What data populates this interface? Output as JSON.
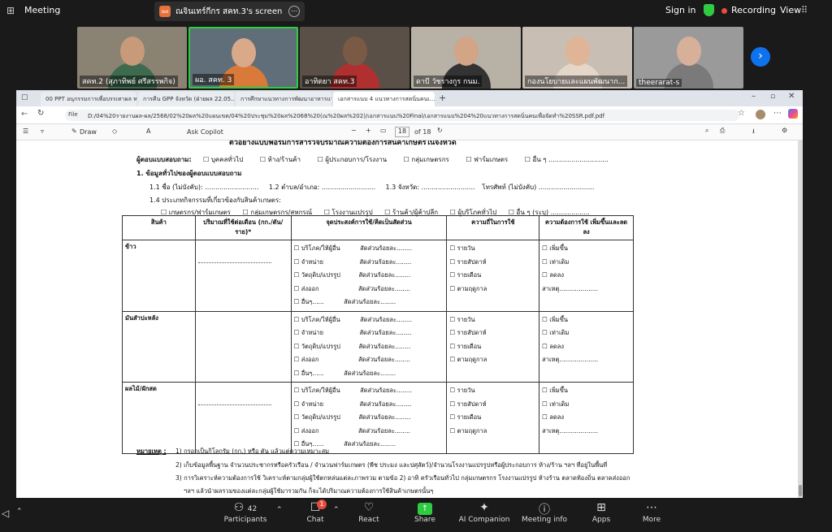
{
  "zoom": {
    "meeting_title": "Meeting",
    "share_label": "ณจินเทร์กีกร สคท.3's screen",
    "share_badge": "ณจ",
    "sign_in": "Sign in",
    "recording": "Recording",
    "view": "View"
  },
  "participants_tiles": [
    {
      "name": "สคท.2 (สุภาทิพย์ ศรีสรรพกิจ)"
    },
    {
      "name": "ผอ. สคท. 3"
    },
    {
      "name": "อาทิตยา สคท.3"
    },
    {
      "name": "ดาบี วัชรางกูร กนม."
    },
    {
      "name": "กองนโยบายและแผนพัฒนาก..."
    },
    {
      "name": "theerarat-s"
    }
  ],
  "browser": {
    "tabs": [
      {
        "label": "00 PPT อนุกรรมการเพื่อบรรเทาผล หรือ..."
      },
      {
        "label": "การคืน GPP จังหวัด (ฝ่ายผล 22.05..."
      },
      {
        "label": "การศึกษาแนวทางการพัฒนาอาหารแปร..."
      },
      {
        "label": "เอกสารแนบ 4 แนวทางการสดนิ่นคนเ..."
      }
    ],
    "file_label": "File",
    "url": "D:/04%20รายงานผล-ผล/2568/02%20ผล%20แผนเขต/04%20ประชุม%20ผล%2068%20(ณ%20ผล%202)/เอกสารแนบ%20Final/เอกสารแนบ%204%20แนวทางการสดนิ่นคนเพื่อจัดทำ%20SSR.pdf.pdf",
    "pdf_toolbar": {
      "draw": "Draw",
      "ask_copilot": "Ask Copilot",
      "page_current": "18",
      "page_total": "of 18"
    }
  },
  "document": {
    "header_cut": "ตัวอย่างแบบฟอร์มการสำรวจปริมาณความต้องการสินค้าเกษตรในจังหวัด",
    "respondent_label": "ผู้ตอบแบบสอบถาม:",
    "respondent_options": [
      "บุคคลทั่วไป",
      "ห้าง/ร้านค้า",
      "ผู้ประกอบการ/โรงงาน",
      "กลุ่มเกษตรกร",
      "ฟาร์มเกษตร",
      "อื่น ๆ"
    ],
    "section1": "1. ข้อมูลทั่วไปของผู้ตอบแบบสอบถาม",
    "field_1_1": "1.1 ชื่อ (ไม่บังคับ):",
    "field_1_2": "1.2 ตำบล/อำเภอ:",
    "field_1_3": "1.3 จังหวัด:",
    "field_phone": "โทรศัพท์ (ไม่บังคับ)",
    "field_1_4": "1.4 ประเภทกิจกรรมที่เกี่ยวข้องกับสินค้าเกษตร:",
    "activity_options": [
      "เกษตรกร/ฟาร์มเกษตร",
      "กลุ่มเกษตรกร/สหกรณ์",
      "โรงงานแปรรูป",
      "ร้านค้า/ผู้ค้าปลีก",
      "ผู้บริโภคทั่วไป",
      "อื่น ๆ (ระบุ)"
    ],
    "table_headers": [
      "สินค้า",
      "ปริมาณที่ใช้ต่อเดือน (กก./ตัน/ราย)*",
      "จุดประสงค์การใช้/คิดเป็นสัดส่วน",
      "ความถี่ในการใช้",
      "ความต้องการใช้ เพิ่มขึ้นและลดลง"
    ],
    "rows": [
      {
        "product": "ข้าว"
      },
      {
        "product": "มันสำปะหลัง"
      },
      {
        "product": "ผลไม้/ผักสด"
      }
    ],
    "purpose_options": [
      "บริโภค/ให้ผู้อื่น",
      "จำหน่าย",
      "วัตถุดิบ/แปรรูป",
      "ส่งออก",
      "อื่นๆ"
    ],
    "ratio_label": "สัดส่วนร้อยละ",
    "frequency_options": [
      "รายวัน",
      "รายสัปดาห์",
      "รายเดือน",
      "ตามฤดูกาล"
    ],
    "demand_options": [
      "เพิ่มขึ้น",
      "เท่าเดิม",
      "ลดลง"
    ],
    "cause_label": "สาเหตุ",
    "notes_label": "หมายเหตุ :",
    "notes": [
      "1) กรอกเป็นกิโลกรัม (กก.) หรือ ตัน แล้วแต่ความเหมาะสม",
      "2) เก็บข้อมูลพื้นฐาน จำนวนประชากรหรือครัวเรือน / จำนวนฟาร์มเกษตร (พืช ประมง และปศุสัตว์)/จำนวนโรงงานแปรรูปหรือผู้ประกอบการ ห้าง/ร้าน ฯลฯ ที่อยู่ในพื้นที่",
      "3) การวิเคราะห์ความต้องการใช้ วิเคราะห์ตามกลุ่มผู้ใช้ตกหล่นแต่ละภาพรวม ตามข้อ 2) อาทิ ครัวเรือนทั่วไป กลุ่มเกษตรกร โรงงานแปรรูป ห้างร้าน ตลาดท้องถิ่น ตลาดส่งออก",
      "ฯลฯ แล้วนำผลรวมของแต่ละกลุ่มผู้ใช้มารวมกัน ก็จะได้ปริมาณความต้องการใช้สินค้าเกษตรนั้นๆ"
    ]
  },
  "bottom_bar": {
    "participants_count": "42",
    "participants": "Participants",
    "chat_badge": "1",
    "chat": "Chat",
    "react": "React",
    "share": "Share",
    "ai_companion": "AI Companion",
    "meeting_info": "Meeting info",
    "apps": "Apps",
    "more": "More"
  }
}
